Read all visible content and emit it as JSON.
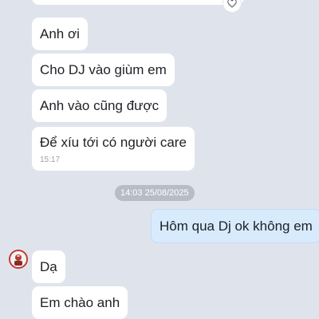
{
  "messages": {
    "incoming_1": "Anh ơi",
    "incoming_2": "Cho DJ vào giùm em",
    "incoming_3": "Anh vào cũng được",
    "incoming_4": "Để xíu tới có người care",
    "incoming_4_time": "15:17",
    "date_separator": "14:03 25/08/2025",
    "outgoing_1": "Hôm qua Dj ok không em",
    "incoming_5": "Dạ",
    "incoming_6": "Em chào anh"
  },
  "icons": {
    "reaction": "heart-icon",
    "sender_avatar": "avatar"
  },
  "colors": {
    "background": "#dfe4ec",
    "incoming_bubble": "#ffffff",
    "outgoing_bubble": "#d8ebfd",
    "date_pill": "#b7bdc6",
    "avatar_ring": "#c8352f"
  }
}
